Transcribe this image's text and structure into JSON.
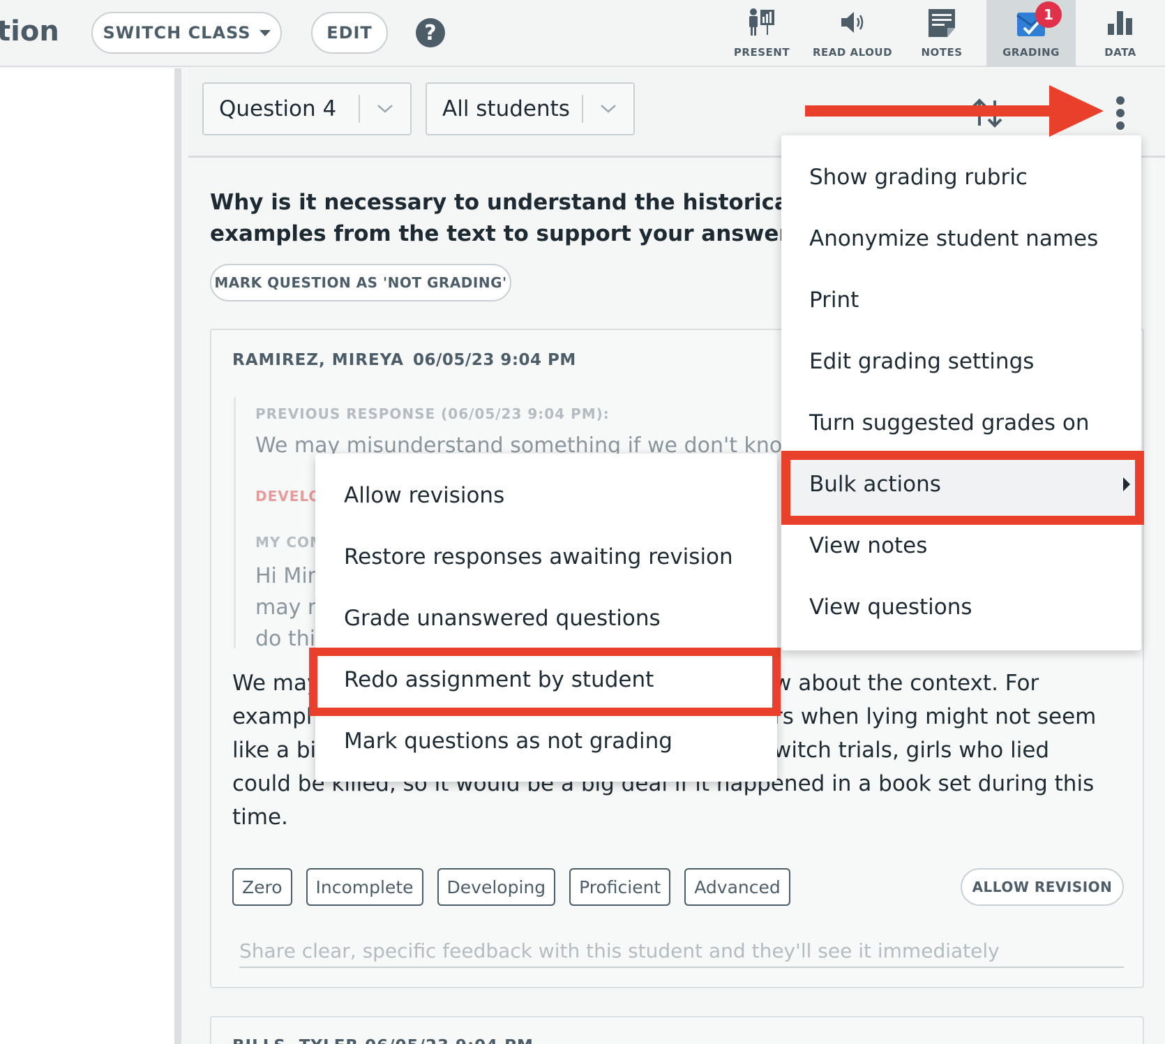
{
  "header": {
    "app_title": "tion",
    "switch_class_label": "SWITCH CLASS",
    "edit_label": "EDIT",
    "help_label": "?",
    "tools": [
      {
        "label": "PRESENT",
        "icon": "present-icon"
      },
      {
        "label": "READ ALOUD",
        "icon": "speaker-icon"
      },
      {
        "label": "NOTES",
        "icon": "notes-icon"
      },
      {
        "label": "GRADING",
        "icon": "grading-icon",
        "badge": "1",
        "active": true
      },
      {
        "label": "DATA",
        "icon": "bar-chart-icon"
      }
    ]
  },
  "filters": {
    "question": "Question 4",
    "students": "All students"
  },
  "question": {
    "text": "Why is it necessary to understand the historical con",
    "text_line2": "examples from the text to support your answer.",
    "not_grading_label": "MARK QUESTION AS 'NOT GRADING'"
  },
  "response": {
    "student": "RAMIREZ, MIREYA",
    "date": "06/05/23 9:04 PM",
    "previous_label": "PREVIOUS RESPONSE (06/05/23 9:04 PM):",
    "previous_text": "We may misunderstand something if we don't know",
    "previous_grade": "DEVELO",
    "my_comment_label": "MY COM",
    "comment_lines": [
      "Hi Mir",
      "may n",
      "do thi"
    ],
    "answer_lines": [
      "We may",
      "exampl",
      "like a bi",
      "could be killed, so it would be a big deal if it happened in a book set during this",
      "time."
    ],
    "answer_right_lines": [
      "w about the context. For",
      "rs when lying might not seem",
      "witch trials, girls who lied"
    ],
    "grades": [
      "Zero",
      "Incomplete",
      "Developing",
      "Proficient",
      "Advanced"
    ],
    "allow_revision_label": "ALLOW REVISION",
    "feedback_placeholder": "Share clear, specific feedback with this student and they'll see it immediately"
  },
  "next_response": {
    "student": "BILLS, TYLER   06/05/23 9:04 PM"
  },
  "menu": {
    "items": [
      "Show grading rubric",
      "Anonymize student names",
      "Print",
      "Edit grading settings",
      "Turn suggested grades on",
      "Bulk actions",
      "View notes",
      "View questions"
    ]
  },
  "submenu": {
    "items": [
      "Allow revisions",
      "Restore responses awaiting revision",
      "Grade unanswered questions",
      "Redo assignment by student",
      "Mark questions as not grading"
    ]
  },
  "colors": {
    "annotation": "#e8402b",
    "badge": "#e0314b",
    "grading_blue": "#2f7fd4",
    "text_dark": "#1e2a32",
    "text_slate": "#4d5d68"
  }
}
